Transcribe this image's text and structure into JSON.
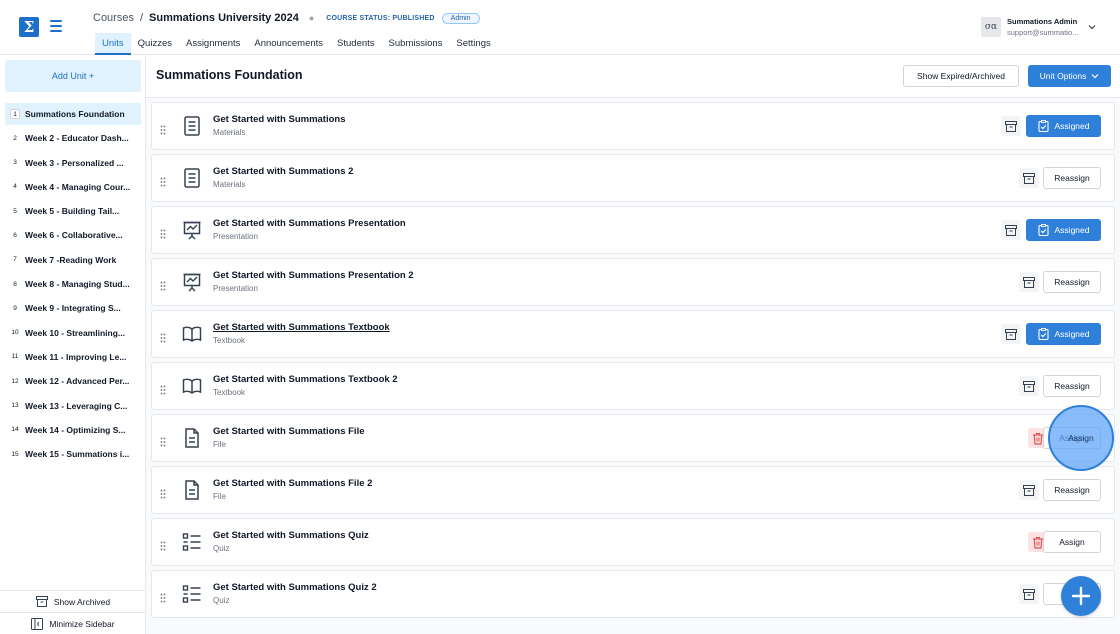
{
  "header": {
    "logo_glyph": "Σ",
    "breadcrumb_root": "Courses",
    "breadcrumb_sep": "/",
    "course_title": "Summations University 2024",
    "course_status": "COURSE STATUS: PUBLISHED",
    "role_badge": "Admin",
    "user": {
      "initials": "σα",
      "name": "Summations Admin",
      "email": "support@summatio..."
    }
  },
  "tabs": [
    {
      "label": "Units",
      "active": true
    },
    {
      "label": "Quizzes",
      "active": false
    },
    {
      "label": "Assignments",
      "active": false
    },
    {
      "label": "Announcements",
      "active": false
    },
    {
      "label": "Students",
      "active": false
    },
    {
      "label": "Submissions",
      "active": false
    },
    {
      "label": "Settings",
      "active": false
    }
  ],
  "sidebar": {
    "add_unit_label": "Add Unit +",
    "units": [
      {
        "num": "1",
        "label": "Summations Foundation",
        "active": true
      },
      {
        "num": "2",
        "label": "Week 2 - Educator Dash...",
        "active": false
      },
      {
        "num": "3",
        "label": "Week 3 - Personalized ...",
        "active": false
      },
      {
        "num": "4",
        "label": "Week 4 - Managing Cour...",
        "active": false
      },
      {
        "num": "5",
        "label": "Week 5 - Building Tail...",
        "active": false
      },
      {
        "num": "6",
        "label": "Week 6 - Collaborative...",
        "active": false
      },
      {
        "num": "7",
        "label": "Week 7 -Reading Work",
        "active": false
      },
      {
        "num": "8",
        "label": "Week 8 - Managing Stud...",
        "active": false
      },
      {
        "num": "9",
        "label": "Week 9 - Integrating S...",
        "active": false
      },
      {
        "num": "10",
        "label": "Week 10 - Streamlining...",
        "active": false
      },
      {
        "num": "11",
        "label": "Week 11 - Improving Le...",
        "active": false
      },
      {
        "num": "12",
        "label": "Week 12 - Advanced Per...",
        "active": false
      },
      {
        "num": "13",
        "label": "Week 13 - Leveraging C...",
        "active": false
      },
      {
        "num": "14",
        "label": "Week 14 - Optimizing S...",
        "active": false
      },
      {
        "num": "15",
        "label": "Week 15 - Summations i...",
        "active": false
      }
    ],
    "show_archived_label": "Show Archived",
    "minimize_label": "Minimize Sidebar"
  },
  "main": {
    "title": "Summations Foundation",
    "show_expired_label": "Show Expired/Archived",
    "unit_options_label": "Unit Options",
    "rows": [
      {
        "title": "Get Started with Summations",
        "type": "Materials",
        "icon": "document-icon",
        "action": "Assigned",
        "archive": "archive",
        "underline": false
      },
      {
        "title": "Get Started with Summations 2",
        "type": "Materials",
        "icon": "document-icon",
        "action": "Reassign",
        "archive": "archive",
        "underline": false
      },
      {
        "title": "Get Started with Summations Presentation",
        "type": "Presentation",
        "icon": "presentation-icon",
        "action": "Assigned",
        "archive": "archive",
        "underline": false
      },
      {
        "title": "Get Started with Summations Presentation 2",
        "type": "Presentation",
        "icon": "presentation-icon",
        "action": "Reassign",
        "archive": "archive",
        "underline": false
      },
      {
        "title": "Get Started with Summations Textbook",
        "type": "Textbook",
        "icon": "book-icon",
        "action": "Assigned",
        "archive": "archive",
        "underline": true
      },
      {
        "title": "Get Started with Summations Textbook 2",
        "type": "Textbook",
        "icon": "book-icon",
        "action": "Reassign",
        "archive": "archive",
        "underline": false
      },
      {
        "title": "Get Started with Summations File",
        "type": "File",
        "icon": "file-icon",
        "action": "Assign",
        "archive": "delete",
        "underline": false
      },
      {
        "title": "Get Started with Summations File 2",
        "type": "File",
        "icon": "file-icon",
        "action": "Reassign",
        "archive": "archive",
        "underline": false
      },
      {
        "title": "Get Started with Summations Quiz",
        "type": "Quiz",
        "icon": "quiz-icon",
        "action": "Assign",
        "archive": "delete",
        "underline": false
      },
      {
        "title": "Get Started with Summations Quiz 2",
        "type": "Quiz",
        "icon": "quiz-icon",
        "action": "R",
        "archive": "archive",
        "underline": false
      }
    ],
    "highlight_label": "Assign"
  },
  "colors": {
    "accent": "#2f80d8",
    "accent_light": "#e0f2fe",
    "danger_bg": "#fee2e2",
    "danger": "#e05252"
  }
}
